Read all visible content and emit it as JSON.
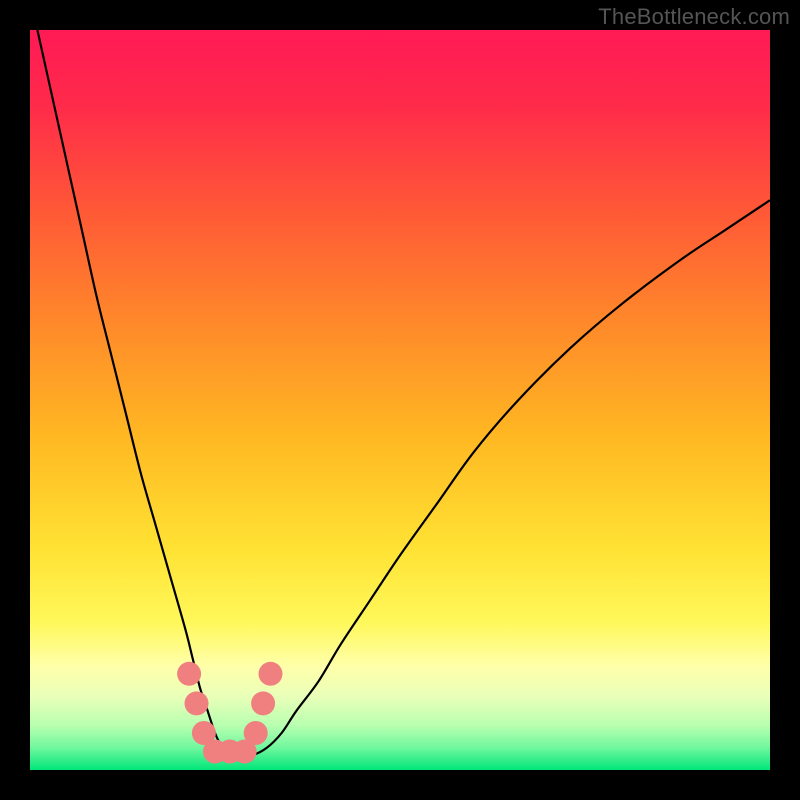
{
  "watermark": "TheBottleneck.com",
  "chart_data": {
    "type": "line",
    "title": "",
    "xlabel": "",
    "ylabel": "",
    "xlim": [
      0,
      100
    ],
    "ylim": [
      0,
      100
    ],
    "background_gradient": {
      "stops": [
        {
          "offset": 0.0,
          "color": "#ff1a55"
        },
        {
          "offset": 0.1,
          "color": "#ff2a4a"
        },
        {
          "offset": 0.25,
          "color": "#ff5a36"
        },
        {
          "offset": 0.4,
          "color": "#ff8a2a"
        },
        {
          "offset": 0.55,
          "color": "#ffb822"
        },
        {
          "offset": 0.7,
          "color": "#ffe233"
        },
        {
          "offset": 0.8,
          "color": "#fff85a"
        },
        {
          "offset": 0.86,
          "color": "#ffffaa"
        },
        {
          "offset": 0.9,
          "color": "#eaffb8"
        },
        {
          "offset": 0.94,
          "color": "#b8ffb0"
        },
        {
          "offset": 0.97,
          "color": "#70f79e"
        },
        {
          "offset": 1.0,
          "color": "#00e67a"
        }
      ]
    },
    "series": [
      {
        "name": "curve",
        "color": "#000000",
        "x": [
          1,
          3,
          5,
          7,
          9,
          11,
          13,
          15,
          17,
          19,
          21,
          22,
          23,
          24,
          25,
          26,
          27,
          28,
          30,
          32,
          34,
          36,
          39,
          42,
          46,
          50,
          55,
          60,
          66,
          73,
          80,
          88,
          94,
          100
        ],
        "y": [
          100,
          91,
          82,
          73,
          64,
          56,
          48,
          40,
          33,
          26,
          19,
          15,
          11,
          8,
          5,
          3,
          2,
          2,
          2,
          3,
          5,
          8,
          12,
          17,
          23,
          29,
          36,
          43,
          50,
          57,
          63,
          69,
          73,
          77
        ]
      }
    ],
    "markers": {
      "color": "#f08080",
      "radius": 12,
      "points": [
        {
          "x": 21.5,
          "y": 13
        },
        {
          "x": 22.5,
          "y": 9
        },
        {
          "x": 23.5,
          "y": 5
        },
        {
          "x": 25.0,
          "y": 2.5
        },
        {
          "x": 27.0,
          "y": 2.5
        },
        {
          "x": 29.0,
          "y": 2.5
        },
        {
          "x": 30.5,
          "y": 5
        },
        {
          "x": 31.5,
          "y": 9
        },
        {
          "x": 32.5,
          "y": 13
        }
      ]
    }
  }
}
